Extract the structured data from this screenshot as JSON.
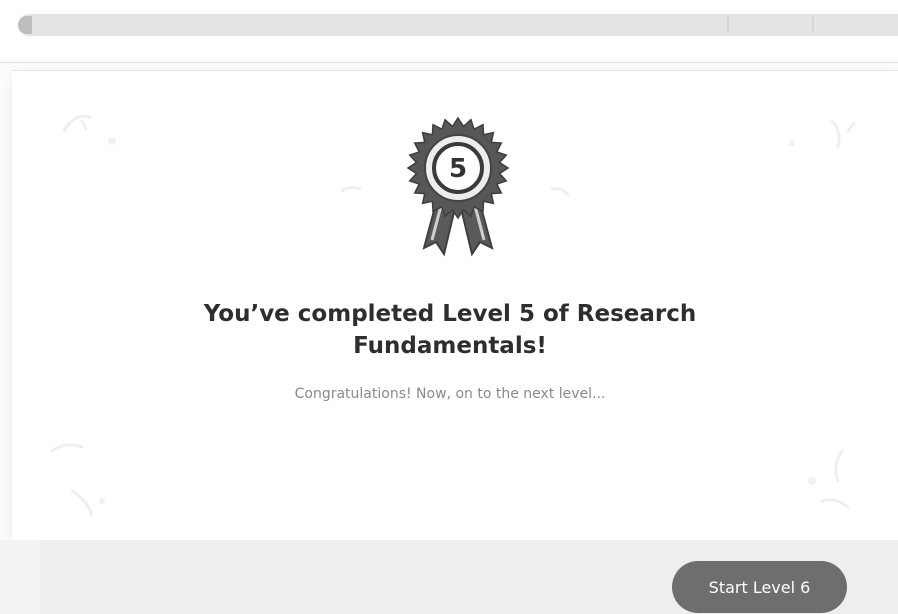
{
  "progress": {
    "fraction": 1.0
  },
  "badge": {
    "level_number": "5",
    "icon": "award-ribbon-icon"
  },
  "completion": {
    "title": "You’ve completed Level 5 of Research Fundamentals!",
    "subtitle": "Congratulations! Now, on to the next level..."
  },
  "actions": {
    "start_label": "Start Level 6"
  },
  "colors": {
    "button_bg": "#6e6e6e",
    "title_text": "#2e2e2e",
    "subtitle_text": "#8a8a8a",
    "badge_dark": "#555555"
  }
}
